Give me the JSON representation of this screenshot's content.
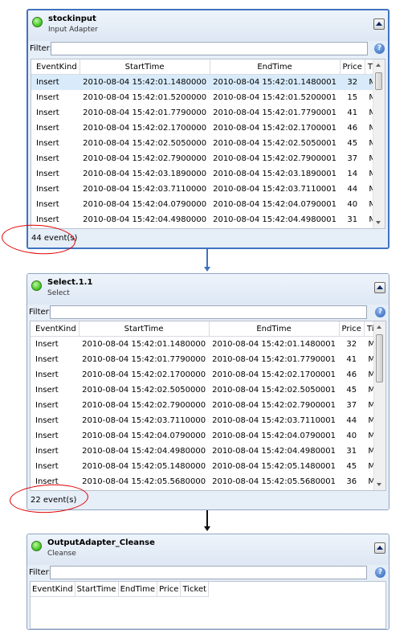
{
  "filter_label": "Filter:",
  "help_glyph": "?",
  "columns": [
    "EventKind",
    "StartTime",
    "EndTime",
    "Price",
    "Ticket"
  ],
  "panels": [
    {
      "title": "stockinput",
      "subtitle": "Input Adapter",
      "count": "44 event(s)",
      "rows": [
        [
          "Insert",
          "2010-08-04 15:42:01.1480000",
          "2010-08-04 15:42:01.1480001",
          "32",
          "MSFT"
        ],
        [
          "Insert",
          "2010-08-04 15:42:01.5200000",
          "2010-08-04 15:42:01.5200001",
          "15",
          "MSFT"
        ],
        [
          "Insert",
          "2010-08-04 15:42:01.7790000",
          "2010-08-04 15:42:01.7790001",
          "41",
          "MSFT"
        ],
        [
          "Insert",
          "2010-08-04 15:42:02.1700000",
          "2010-08-04 15:42:02.1700001",
          "46",
          "MSFT"
        ],
        [
          "Insert",
          "2010-08-04 15:42:02.5050000",
          "2010-08-04 15:42:02.5050001",
          "45",
          "MSFT"
        ],
        [
          "Insert",
          "2010-08-04 15:42:02.7900000",
          "2010-08-04 15:42:02.7900001",
          "37",
          "MSFT"
        ],
        [
          "Insert",
          "2010-08-04 15:42:03.1890000",
          "2010-08-04 15:42:03.1890001",
          "14",
          "MSFT"
        ],
        [
          "Insert",
          "2010-08-04 15:42:03.7110000",
          "2010-08-04 15:42:03.7110001",
          "44",
          "MSFT"
        ],
        [
          "Insert",
          "2010-08-04 15:42:04.0790000",
          "2010-08-04 15:42:04.0790001",
          "40",
          "MSFT"
        ],
        [
          "Insert",
          "2010-08-04 15:42:04.4980000",
          "2010-08-04 15:42:04.4980001",
          "31",
          "MSFT"
        ]
      ]
    },
    {
      "title": "Select.1.1",
      "subtitle": "Select",
      "count": "22 event(s)",
      "rows": [
        [
          "Insert",
          "2010-08-04 15:42:01.1480000",
          "2010-08-04 15:42:01.1480001",
          "32",
          "MSFT"
        ],
        [
          "Insert",
          "2010-08-04 15:42:01.7790000",
          "2010-08-04 15:42:01.7790001",
          "41",
          "MSFT"
        ],
        [
          "Insert",
          "2010-08-04 15:42:02.1700000",
          "2010-08-04 15:42:02.1700001",
          "46",
          "MSFT"
        ],
        [
          "Insert",
          "2010-08-04 15:42:02.5050000",
          "2010-08-04 15:42:02.5050001",
          "45",
          "MSFT"
        ],
        [
          "Insert",
          "2010-08-04 15:42:02.7900000",
          "2010-08-04 15:42:02.7900001",
          "37",
          "MSFT"
        ],
        [
          "Insert",
          "2010-08-04 15:42:03.7110000",
          "2010-08-04 15:42:03.7110001",
          "44",
          "MSFT"
        ],
        [
          "Insert",
          "2010-08-04 15:42:04.0790000",
          "2010-08-04 15:42:04.0790001",
          "40",
          "MSFT"
        ],
        [
          "Insert",
          "2010-08-04 15:42:04.4980000",
          "2010-08-04 15:42:04.4980001",
          "31",
          "MSFT"
        ],
        [
          "Insert",
          "2010-08-04 15:42:05.1480000",
          "2010-08-04 15:42:05.1480001",
          "45",
          "MSFT"
        ],
        [
          "Insert",
          "2010-08-04 15:42:05.5680000",
          "2010-08-04 15:42:05.5680001",
          "36",
          "MSFT"
        ]
      ]
    },
    {
      "title": "OutputAdapter_Cleanse",
      "subtitle": "Cleanse",
      "count": "",
      "rows": []
    }
  ],
  "colors": {
    "connector_blue": "#3f73c0",
    "connector_black": "#111111",
    "annotation_red": "#e00000",
    "selected_row": "#d9ebfb"
  }
}
